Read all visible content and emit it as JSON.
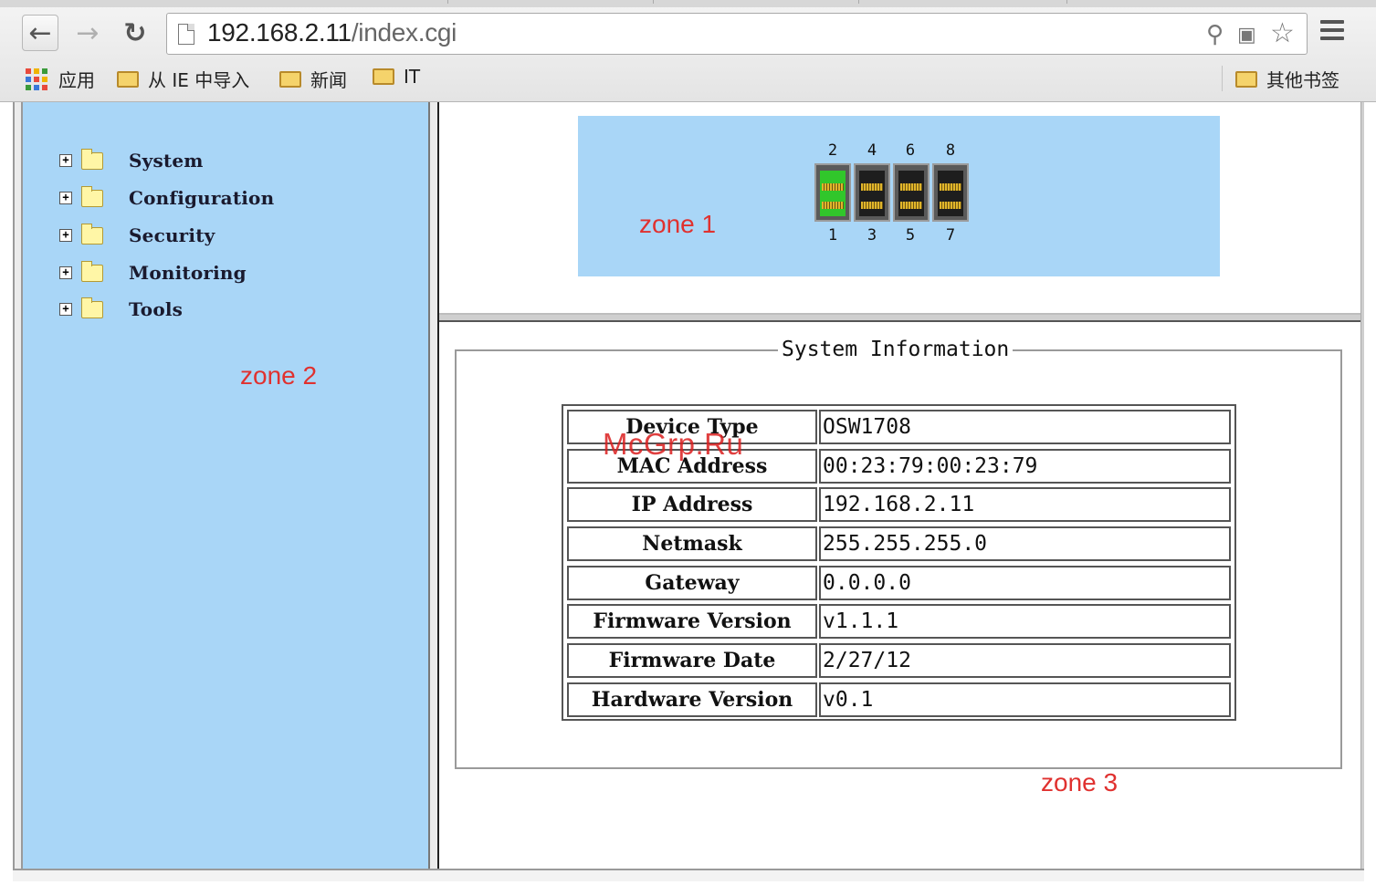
{
  "browser": {
    "url_host": "192.168.2.11",
    "url_path": "/index.cgi",
    "bookmarks": [
      {
        "label": "应用"
      },
      {
        "label": "从 IE 中导入"
      },
      {
        "label": "新闻"
      },
      {
        "label": "IT"
      }
    ],
    "other_bookmarks": "其他书签"
  },
  "sidebar": {
    "items": [
      {
        "label": "System"
      },
      {
        "label": "Configuration"
      },
      {
        "label": "Security"
      },
      {
        "label": "Monitoring"
      },
      {
        "label": "Tools"
      }
    ]
  },
  "zones": {
    "zone1": "zone 1",
    "zone2": "zone 2",
    "zone3": "zone 3"
  },
  "ports": {
    "top_numbers": [
      "2",
      "4",
      "6",
      "8"
    ],
    "bottom_numbers": [
      "1",
      "3",
      "5",
      "7"
    ],
    "active_port": "2",
    "active_color": "#31c62b",
    "inactive_color": "#1e1e1e"
  },
  "system_info": {
    "title": "System Information",
    "rows": [
      {
        "key": "Device Type",
        "value": "OSW1708"
      },
      {
        "key": "MAC Address",
        "value": "00:23:79:00:23:79"
      },
      {
        "key": "IP Address",
        "value": "192.168.2.11"
      },
      {
        "key": "Netmask",
        "value": "255.255.255.0"
      },
      {
        "key": "Gateway",
        "value": "0.0.0.0"
      },
      {
        "key": "Firmware Version",
        "value": "v1.1.1"
      },
      {
        "key": "Firmware Date",
        "value": "2/27/12"
      },
      {
        "key": "Hardware Version",
        "value": "v0.1"
      }
    ]
  },
  "watermark": "McGrp.Ru",
  "colors": {
    "panel_blue": "#a9d6f7",
    "zone_label_red": "#e0312f"
  }
}
